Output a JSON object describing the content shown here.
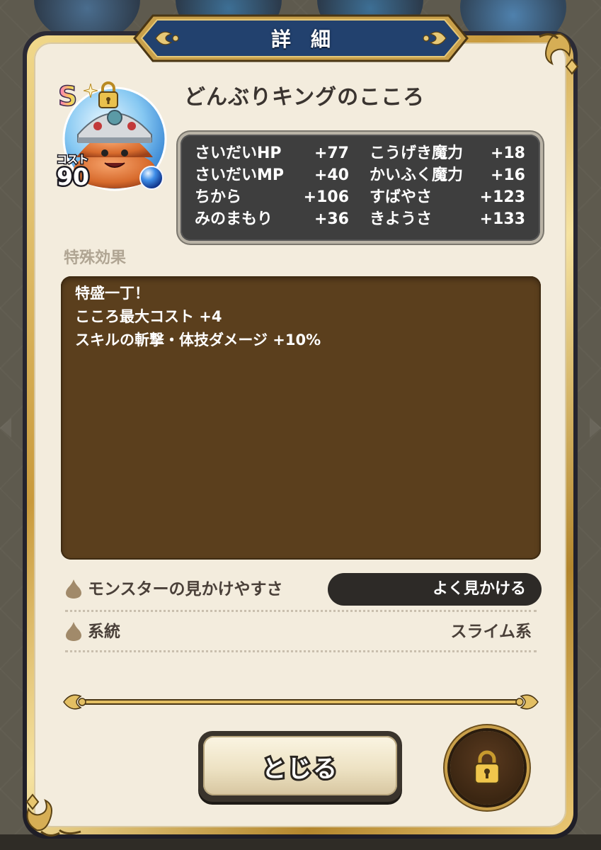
{
  "header": {
    "title": "詳細"
  },
  "monster": {
    "rank": "S",
    "cost_label": "コスト",
    "cost_value": "90",
    "name": "どんぶりキングのこころ"
  },
  "stats": [
    {
      "label": "さいだいHP",
      "value": "+77"
    },
    {
      "label": "さいだいMP",
      "value": "+40"
    },
    {
      "label": "ちから",
      "value": "+106"
    },
    {
      "label": "みのまもり",
      "value": "+36"
    },
    {
      "label": "こうげき魔力",
      "value": "+18"
    },
    {
      "label": "かいふく魔力",
      "value": "+16"
    },
    {
      "label": "すばやさ",
      "value": "+123"
    },
    {
      "label": "きようさ",
      "value": "+133"
    }
  ],
  "effects": {
    "heading": "特殊効果",
    "lines": [
      "特盛一丁！",
      "こころ最大コスト +4",
      "スキルの斬撃・体技ダメージ +10%"
    ]
  },
  "info": {
    "visibility_label": "モンスターの見かけやすさ",
    "visibility_value": "よく見かける",
    "family_label": "系統",
    "family_value": "スライム系"
  },
  "buttons": {
    "close_label": "とじる"
  },
  "icons": {
    "rank": "rank-s-icon",
    "lock_small": "lock-icon",
    "orb": "blue-orb-icon",
    "drop": "slime-drop-icon",
    "lock_button": "padlock-icon"
  },
  "colors": {
    "header_plate": "#22416e",
    "gold": "#d9b25a",
    "panel": "#f3ecdd",
    "stats_bg": "#3e3e3e",
    "effects_bg": "#5b3f1d",
    "pill_bg": "#2d2a27"
  }
}
